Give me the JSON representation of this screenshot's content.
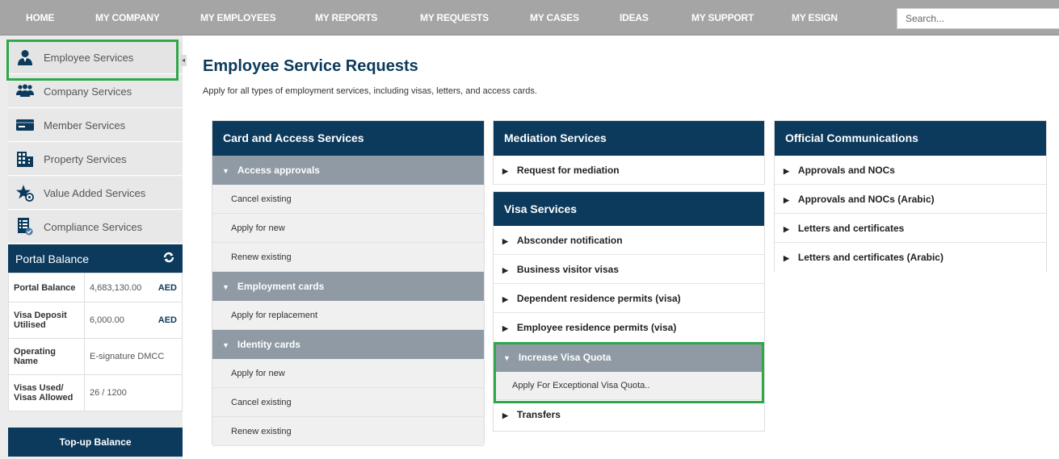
{
  "nav": {
    "items": [
      "HOME",
      "MY COMPANY",
      "MY EMPLOYEES",
      "MY REPORTS",
      "MY REQUESTS",
      "MY CASES",
      "IDEAS",
      "MY SUPPORT",
      "MY ESIGN"
    ],
    "search_placeholder": "Search..."
  },
  "sidebar": {
    "items": [
      {
        "label": "Employee Services",
        "icon": "user-icon"
      },
      {
        "label": "Company Services",
        "icon": "group-icon"
      },
      {
        "label": "Member Services",
        "icon": "card-icon"
      },
      {
        "label": "Property Services",
        "icon": "building-icon"
      },
      {
        "label": "Value Added Services",
        "icon": "star-gear-icon"
      },
      {
        "label": "Compliance Services",
        "icon": "document-icon"
      }
    ],
    "collapse_glyph": "◂"
  },
  "balance": {
    "title": "Portal Balance",
    "rows": [
      {
        "label": "Portal Balance",
        "value": "4,683,130.00",
        "currency": "AED"
      },
      {
        "label": "Visa Deposit Utilised",
        "value": "6,000.00",
        "currency": "AED"
      },
      {
        "label": "Operating Name",
        "value": "E-signature DMCC",
        "currency": ""
      },
      {
        "label": "Visas Used/ Visas Allowed",
        "value": "26 / 1200",
        "currency": ""
      }
    ],
    "topup_label": "Top-up Balance"
  },
  "main": {
    "title": "Employee Service Requests",
    "subtitle": "Apply for all types of employment services, including visas, letters, and access cards."
  },
  "card_access": {
    "title": "Card and Access Services",
    "groups": [
      {
        "label": "Access approvals",
        "items": [
          "Cancel existing",
          "Apply for new",
          "Renew existing"
        ]
      },
      {
        "label": "Employment cards",
        "items": [
          "Apply for replacement"
        ]
      },
      {
        "label": "Identity cards",
        "items": [
          "Apply for new",
          "Cancel existing",
          "Renew existing"
        ]
      }
    ]
  },
  "mediation": {
    "title": "Mediation Services",
    "items": [
      "Request for mediation"
    ]
  },
  "visa": {
    "title": "Visa Services",
    "items": [
      "Absconder notification",
      "Business visitor visas",
      "Dependent residence permits (visa)",
      "Employee residence permits (visa)"
    ],
    "expanded_group": {
      "label": "Increase Visa Quota",
      "items": [
        "Apply For Exceptional Visa Quota.."
      ]
    },
    "after_items": [
      "Transfers"
    ]
  },
  "official": {
    "title": "Official Communications",
    "items": [
      "Approvals and NOCs",
      "Approvals and NOCs (Arabic)",
      "Letters and certificates",
      "Letters and certificates (Arabic)"
    ]
  },
  "colors": {
    "navy": "#0c3a5c",
    "highlight": "#2fa84a",
    "nav_bg": "#a5a5a5",
    "group_bg": "#8f9aa4"
  }
}
